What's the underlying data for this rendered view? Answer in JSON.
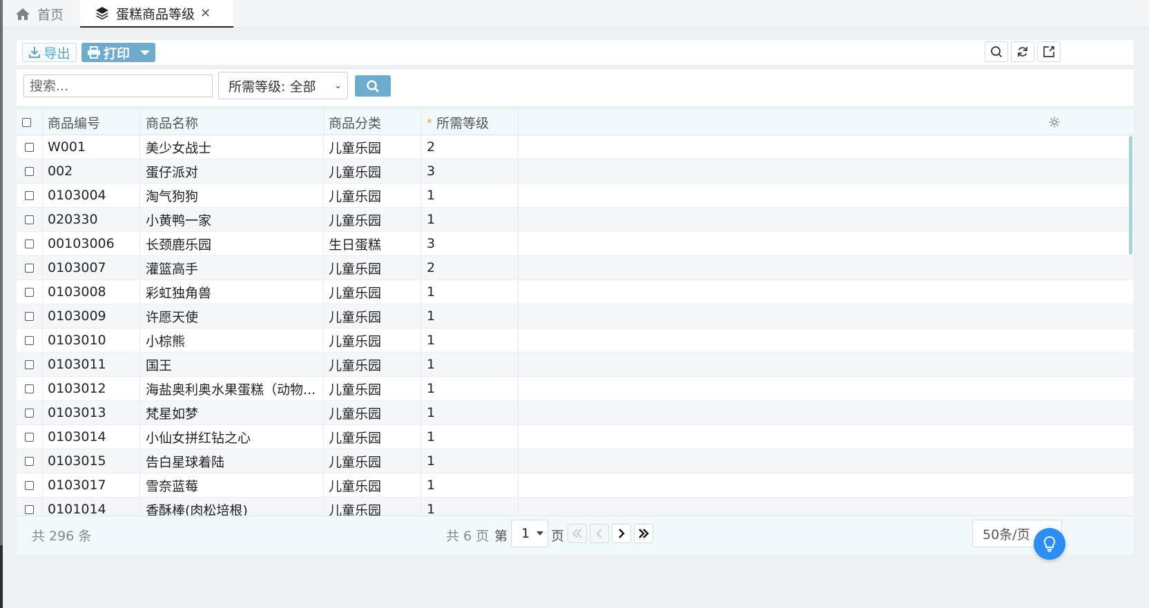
{
  "tabs": [
    {
      "label": "首页",
      "icon": "home-icon"
    },
    {
      "label": "蛋糕商品等级",
      "icon": "layers-icon",
      "closable": true
    }
  ],
  "toolbar": {
    "export_label": "导出",
    "print_label": "打印",
    "right_icons": [
      "search-icon",
      "refresh-icon",
      "export-window-icon"
    ]
  },
  "search": {
    "placeholder": "搜索...",
    "level_filter": "所需等级: 全部"
  },
  "table": {
    "columns": [
      "商品编号",
      "商品名称",
      "商品分类",
      "所需等级"
    ],
    "required_mark": "*",
    "rows": [
      {
        "code": "W001",
        "name": "美少女战士",
        "category": "儿童乐园",
        "level": "2"
      },
      {
        "code": "002",
        "name": "蛋仔派对",
        "category": "儿童乐园",
        "level": "3"
      },
      {
        "code": "0103004",
        "name": "淘气狗狗",
        "category": "儿童乐园",
        "level": "1"
      },
      {
        "code": "020330",
        "name": "小黄鸭一家",
        "category": "儿童乐园",
        "level": "1"
      },
      {
        "code": "00103006",
        "name": "长颈鹿乐园",
        "category": "生日蛋糕",
        "level": "3"
      },
      {
        "code": "0103007",
        "name": "灌篮高手",
        "category": "儿童乐园",
        "level": "2"
      },
      {
        "code": "0103008",
        "name": "彩虹独角兽",
        "category": "儿童乐园",
        "level": "1"
      },
      {
        "code": "0103009",
        "name": "许愿天使",
        "category": "儿童乐园",
        "level": "1"
      },
      {
        "code": "0103010",
        "name": "小棕熊",
        "category": "儿童乐园",
        "level": "1"
      },
      {
        "code": "0103011",
        "name": "国王",
        "category": "儿童乐园",
        "level": "1"
      },
      {
        "code": "0103012",
        "name": "海盐奥利奥水果蛋糕（动物...",
        "category": "儿童乐园",
        "level": "1"
      },
      {
        "code": "0103013",
        "name": "梵星如梦",
        "category": "儿童乐园",
        "level": "1"
      },
      {
        "code": "0103014",
        "name": "小仙女拼红钻之心",
        "category": "儿童乐园",
        "level": "1"
      },
      {
        "code": "0103015",
        "name": "告白星球着陆",
        "category": "儿童乐园",
        "level": "1"
      },
      {
        "code": "0103017",
        "name": "雪奈蓝莓",
        "category": "儿童乐园",
        "level": "1"
      },
      {
        "code": "0101014",
        "name": "香酥棒(肉松培根)",
        "category": "儿童乐园",
        "level": "1"
      }
    ]
  },
  "pager": {
    "total": "共 296 条",
    "pages": "共 6 页",
    "page_prefix": "第",
    "current_page": "1",
    "page_suffix": "页",
    "per_page": "50条/页"
  },
  "colors": {
    "accent": "#6eabcd",
    "header_bg": "#f1f9fc",
    "fab": "#2b8ef0",
    "required": "#e6a23c"
  }
}
